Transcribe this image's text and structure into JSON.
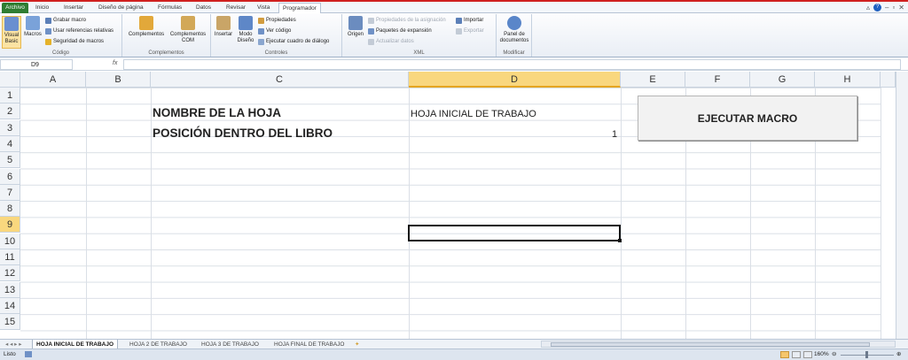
{
  "tabs": {
    "file": "Archivo",
    "items": [
      "Inicio",
      "Insertar",
      "Diseño de página",
      "Fórmulas",
      "Datos",
      "Revisar",
      "Vista"
    ],
    "active": "Programador"
  },
  "ribbon": {
    "codigo": {
      "label": "Código",
      "vb": "Visual Basic",
      "macros": "Macros",
      "grabar": "Grabar macro",
      "refs": "Usar referencias relativas",
      "seg": "Seguridad de macros"
    },
    "complementos": {
      "label": "Complementos",
      "c1": "Complementos",
      "c2": "Complementos COM"
    },
    "controles": {
      "label": "Controles",
      "insertar": "Insertar",
      "modo": "Modo Diseño",
      "props": "Propiedades",
      "vercod": "Ver código",
      "ejec": "Ejecutar cuadro de diálogo"
    },
    "xml": {
      "label": "XML",
      "origen": "Origen",
      "propasig": "Propiedades de la asignación",
      "paquetes": "Paquetes de expansión",
      "actualizar": "Actualizar datos",
      "importar": "Importar",
      "exportar": "Exportar"
    },
    "modificar": {
      "label": "Modificar",
      "panel": "Panel de documentos"
    }
  },
  "formula": {
    "namebox": "D9",
    "fx": "fx",
    "value": ""
  },
  "columns": [
    "A",
    "B",
    "C",
    "D",
    "E",
    "F",
    "G",
    "H"
  ],
  "rows": [
    "1",
    "2",
    "3",
    "4",
    "5",
    "6",
    "7",
    "8",
    "9",
    "10",
    "11",
    "12",
    "13",
    "14",
    "15"
  ],
  "cells": {
    "c2": "NOMBRE DE LA HOJA",
    "c3": "POSICIÓN DENTRO DEL LIBRO",
    "d2": "HOJA INICIAL DE TRABAJO",
    "d3": "1"
  },
  "macro_button": "EJECUTAR MACRO",
  "sheets": [
    "HOJA INICIAL DE TRABAJO",
    "HOJA 2 DE TRABAJO",
    "HOJA 3 DE TRABAJO",
    "HOJA FINAL DE TRABAJO"
  ],
  "status": {
    "mode": "Listo",
    "zoom": "160%"
  }
}
